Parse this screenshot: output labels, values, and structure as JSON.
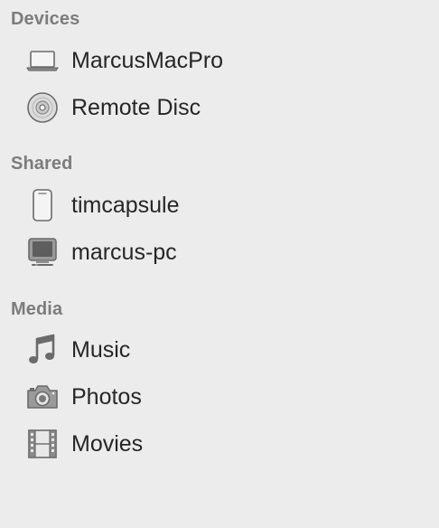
{
  "sidebar": {
    "sections": {
      "devices": {
        "header": "Devices",
        "items": [
          {
            "label": "MarcusMacPro",
            "icon": "laptop-icon"
          },
          {
            "label": "Remote Disc",
            "icon": "disc-icon"
          }
        ]
      },
      "shared": {
        "header": "Shared",
        "items": [
          {
            "label": "timcapsule",
            "icon": "time-capsule-icon"
          },
          {
            "label": "marcus-pc",
            "icon": "pc-monitor-icon"
          }
        ]
      },
      "media": {
        "header": "Media",
        "items": [
          {
            "label": "Music",
            "icon": "music-note-icon"
          },
          {
            "label": "Photos",
            "icon": "camera-icon"
          },
          {
            "label": "Movies",
            "icon": "film-icon"
          }
        ]
      }
    }
  },
  "colors": {
    "background": "#ececec",
    "header_text": "#7c7c7c",
    "item_text": "#262626",
    "icon_gray": "#6b6b6b"
  }
}
